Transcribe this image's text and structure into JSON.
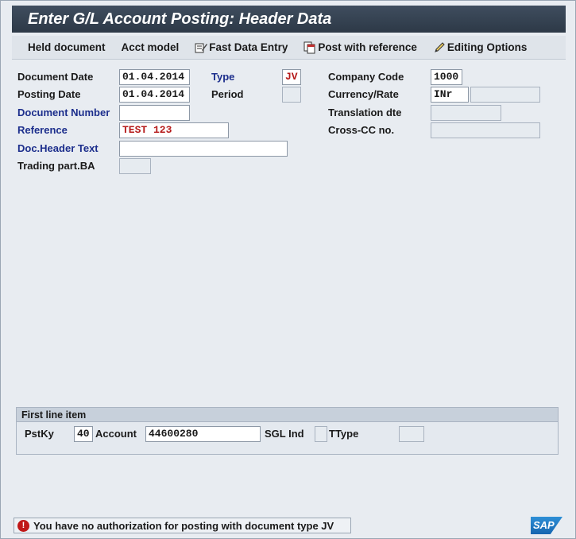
{
  "window": {
    "title": "Enter G/L Account Posting: Header Data"
  },
  "toolbar": {
    "held_document": "Held document",
    "acct_model": "Acct model",
    "fast_data_entry": "Fast Data Entry",
    "post_with_reference": "Post with reference",
    "editing_options": "Editing Options"
  },
  "header": {
    "document_date": {
      "label": "Document Date",
      "value": "01.04.2014"
    },
    "posting_date": {
      "label": "Posting Date",
      "value": "01.04.2014"
    },
    "document_number": {
      "label": "Document Number",
      "value": ""
    },
    "reference": {
      "label": "Reference",
      "value": "TEST 123"
    },
    "doc_header_text": {
      "label": "Doc.Header Text",
      "value": ""
    },
    "trading_part_ba": {
      "label": "Trading part.BA",
      "value": ""
    },
    "type": {
      "label": "Type",
      "value": "JV"
    },
    "period": {
      "label": "Period",
      "value": ""
    },
    "company_code": {
      "label": "Company Code",
      "value": "1000"
    },
    "currency_rate": {
      "label": "Currency/Rate",
      "currency": "INr",
      "rate": ""
    },
    "translation_dte": {
      "label": "Translation dte",
      "value": ""
    },
    "cross_cc_no": {
      "label": "Cross-CC no.",
      "value": ""
    }
  },
  "first_line_item": {
    "title": "First line item",
    "pstky": {
      "label": "PstKy",
      "value": "40"
    },
    "account": {
      "label": "Account",
      "value": "44600280"
    },
    "sgl_ind": {
      "label": "SGL Ind",
      "value": ""
    },
    "ttype": {
      "label": "TType",
      "value": ""
    }
  },
  "status": {
    "message": "You have no authorization for posting with document type JV",
    "icon": "error-icon",
    "logo_text": "SAP"
  },
  "colors": {
    "title_bg": "#33404f",
    "label_blue": "#1c2e8c",
    "value_red": "#b51a1a",
    "error_red": "#c01818"
  }
}
